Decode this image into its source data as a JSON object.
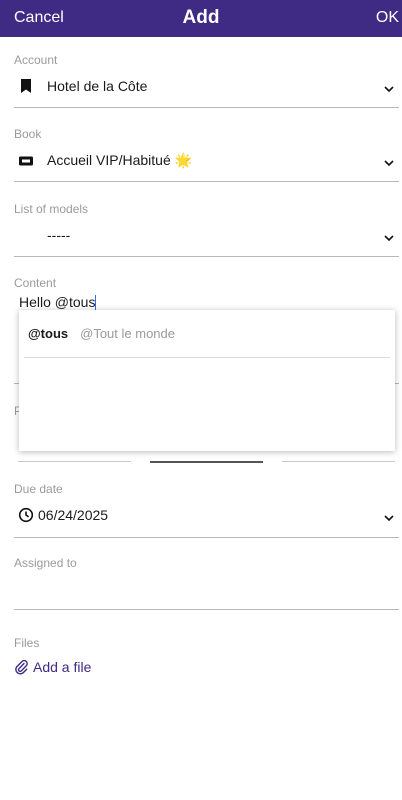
{
  "navbar": {
    "cancel": "Cancel",
    "title": "Add",
    "ok": "OK"
  },
  "account": {
    "label": "Account",
    "value": "Hotel de la Côte",
    "icon": "bookmark-icon"
  },
  "book": {
    "label": "Book",
    "value": "Accueil VIP/Habitué 🌟",
    "icon": "ticket-icon"
  },
  "models": {
    "label": "List of models",
    "value": "-----"
  },
  "content": {
    "label": "Content",
    "value": "Hello @tous"
  },
  "mention_popup": {
    "handle": "@tous",
    "name": "@Tout le monde"
  },
  "due_date": {
    "label": "Due date",
    "value": "06/24/2025",
    "icon": "clock-icon"
  },
  "assigned": {
    "label": "Assigned to",
    "value": ""
  },
  "files": {
    "label": "Files",
    "add_label": "Add a file",
    "icon": "paperclip-icon"
  },
  "colors": {
    "navbar": "#3f2a84",
    "link": "#3f2a84",
    "caret": "#2a6df4"
  }
}
